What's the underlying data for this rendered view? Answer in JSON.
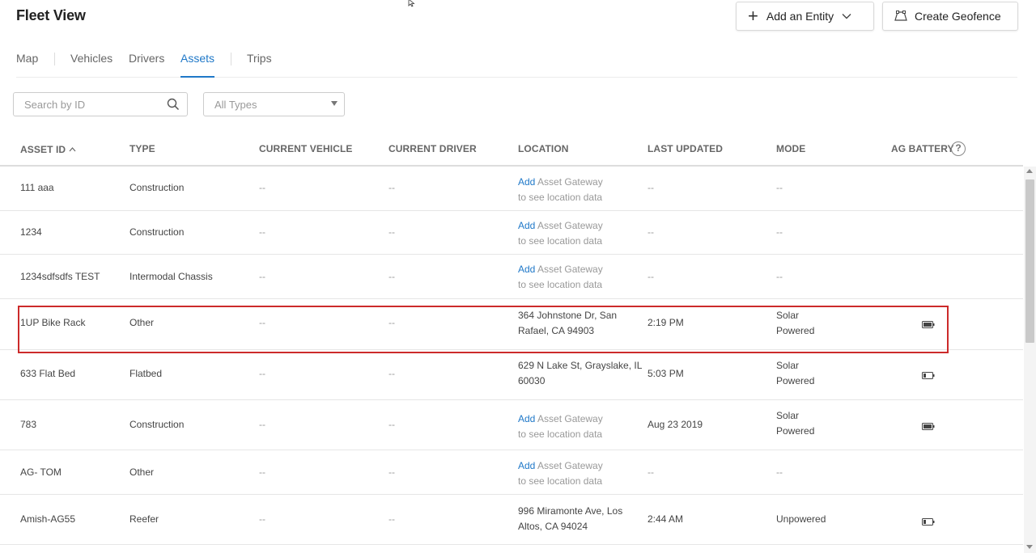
{
  "header": {
    "title": "Fleet View",
    "add_entity_label": "Add an Entity",
    "create_geofence_label": "Create Geofence"
  },
  "tabs": [
    {
      "label": "Map",
      "active": false
    },
    {
      "label": "Vehicles",
      "active": false
    },
    {
      "label": "Drivers",
      "active": false
    },
    {
      "label": "Assets",
      "active": true
    },
    {
      "label": "Trips",
      "active": false
    }
  ],
  "filters": {
    "search_placeholder": "Search by ID",
    "type_select_value": "All Types"
  },
  "table": {
    "columns": [
      "ASSET ID",
      "TYPE",
      "CURRENT VEHICLE",
      "CURRENT DRIVER",
      "LOCATION",
      "LAST UPDATED",
      "MODE",
      "AG BATTERY"
    ],
    "sort_indicator": "ascending",
    "help_symbol": "?",
    "rows": [
      {
        "asset_id": "111 aaa",
        "type": "Construction",
        "vehicle": "--",
        "driver": "--",
        "location_add": "Add",
        "location_rest": " Asset Gateway",
        "location_line2": "to see location data",
        "last_updated": "--",
        "mode_line1": "--",
        "mode_line2": "",
        "battery": ""
      },
      {
        "asset_id": "1234",
        "type": "Construction",
        "vehicle": "--",
        "driver": "--",
        "location_add": "Add",
        "location_rest": " Asset Gateway",
        "location_line2": "to see location data",
        "last_updated": "--",
        "mode_line1": "--",
        "mode_line2": "",
        "battery": ""
      },
      {
        "asset_id": "1234sdfsdfs TEST",
        "type": "Intermodal Chassis",
        "vehicle": "--",
        "driver": "--",
        "location_add": "Add",
        "location_rest": " Asset Gateway",
        "location_line2": "to see location data",
        "last_updated": "--",
        "mode_line1": "--",
        "mode_line2": "",
        "battery": ""
      },
      {
        "asset_id": "1UP Bike Rack",
        "type": "Other",
        "vehicle": "--",
        "driver": "--",
        "location_line1": "364 Johnstone Dr, San",
        "location_line2": "Rafael, CA 94903",
        "last_updated": "2:19 PM",
        "mode_line1": "Solar",
        "mode_line2": "Powered",
        "battery": "full-battery-icon"
      },
      {
        "asset_id": "633 Flat Bed",
        "type": "Flatbed",
        "vehicle": "--",
        "driver": "--",
        "location_line1": "629 N Lake St, Grayslake, IL",
        "location_line2": "60030",
        "last_updated": "5:03 PM",
        "mode_line1": "Solar",
        "mode_line2": "Powered",
        "battery": "low-battery-icon"
      },
      {
        "asset_id": "783",
        "type": "Construction",
        "vehicle": "--",
        "driver": "--",
        "location_add": "Add",
        "location_rest": " Asset Gateway",
        "location_line2": "to see location data",
        "last_updated": "Aug 23 2019",
        "mode_line1": "Solar",
        "mode_line2": "Powered",
        "battery": "full-battery-icon"
      },
      {
        "asset_id": "AG- TOM",
        "type": "Other",
        "vehicle": "--",
        "driver": "--",
        "location_add": "Add",
        "location_rest": " Asset Gateway",
        "location_line2": "to see location data",
        "last_updated": "--",
        "mode_line1": "--",
        "mode_line2": "",
        "battery": ""
      },
      {
        "asset_id": "Amish-AG55",
        "type": "Reefer",
        "vehicle": "--",
        "driver": "--",
        "location_line1": "996 Miramonte Ave, Los",
        "location_line2": "Altos, CA 94024",
        "last_updated": "2:44 AM",
        "mode_line1": "Unpowered",
        "mode_line2": "",
        "battery": "low-battery-icon"
      }
    ]
  },
  "colors": {
    "accent": "#1f78c8",
    "highlight_box": "#cc2a2a"
  }
}
